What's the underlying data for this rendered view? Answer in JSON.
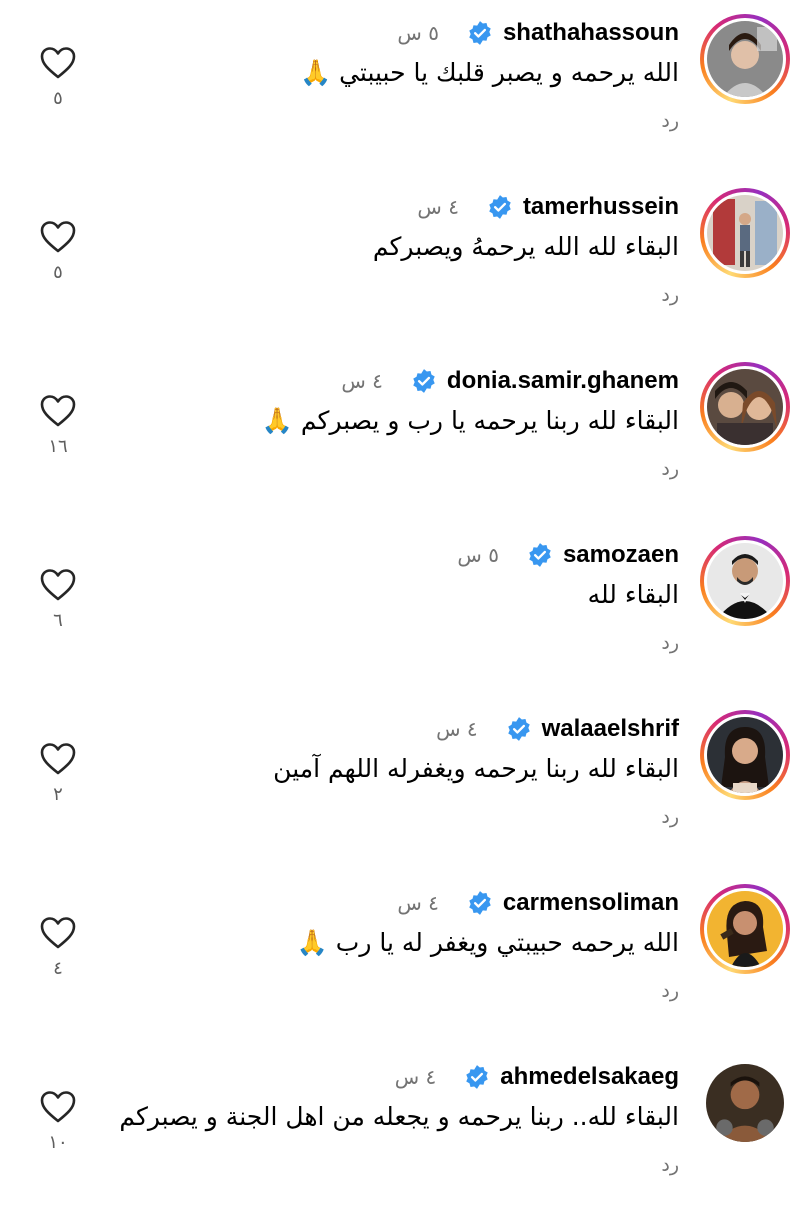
{
  "comments": [
    {
      "username": "shathahassoun",
      "time": "٥ س",
      "text": "الله يرحمه و يصبر قلبك يا حبيبتي 🙏",
      "reply_label": "رد",
      "likes": "٥",
      "story_ring": true
    },
    {
      "username": "tamerhussein",
      "time": "٤ س",
      "text": "البقاء لله الله يرحمهُ ويصبركم",
      "reply_label": "رد",
      "likes": "٥",
      "story_ring": true
    },
    {
      "username": "donia.samir.ghanem",
      "time": "٤ س",
      "text": "البقاء لله ربنا يرحمه يا رب و يصبركم 🙏",
      "reply_label": "رد",
      "likes": "١٦",
      "story_ring": true
    },
    {
      "username": "samozaen",
      "time": "٥ س",
      "text": "البقاء لله",
      "reply_label": "رد",
      "likes": "٦",
      "story_ring": true
    },
    {
      "username": "walaaelshrif",
      "time": "٤ س",
      "text": "البقاء لله ربنا يرحمه ويغفرله اللهم آمين",
      "reply_label": "رد",
      "likes": "٢",
      "story_ring": true
    },
    {
      "username": "carmensoliman",
      "time": "٤ س",
      "text": "الله يرحمه حبيبتي ويغفر له يا رب 🙏",
      "reply_label": "رد",
      "likes": "٤",
      "story_ring": true
    },
    {
      "username": "ahmedelsakaeg",
      "time": "٤ س",
      "text": "البقاء لله.. ربنا يرحمه و يجعله من اهل الجنة و يصبركم",
      "reply_label": "رد",
      "likes": "١٠",
      "story_ring": false
    }
  ],
  "colors": {
    "verified_badge": "#3897f0",
    "secondary_text": "#737373",
    "like_icon": "#262626"
  },
  "icons": {
    "verified": "verified-badge-icon",
    "like": "heart-outline-icon"
  }
}
